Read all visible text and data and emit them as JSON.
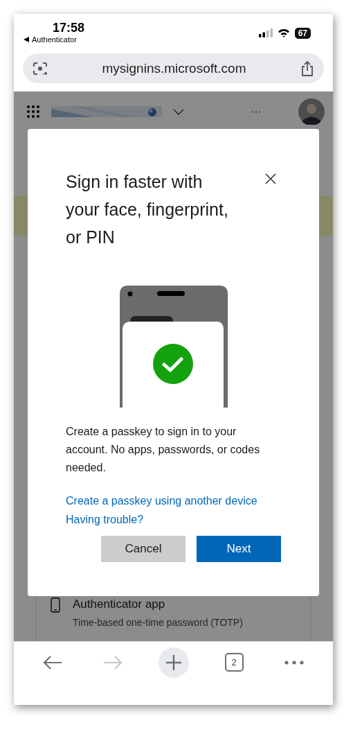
{
  "status_bar": {
    "time": "17:58",
    "back_app": "Authenticator",
    "battery": "67"
  },
  "address_bar": {
    "url": "mysignins.microsoft.com"
  },
  "page": {
    "method": {
      "title": "Authenticator app",
      "subtitle": "Time-based one-time password (TOTP)"
    }
  },
  "dialog": {
    "title": "Sign in faster with your face, fingerprint, or PIN",
    "body": "Create a passkey to sign in to your account. No apps, passwords, or codes needed.",
    "links": [
      "Create a passkey using another device",
      "Having trouble?"
    ],
    "buttons": [
      {
        "label": "Cancel",
        "kind": "secondary"
      },
      {
        "label": "Next",
        "kind": "primary"
      }
    ]
  },
  "toolbar": {
    "tab_count": "2"
  }
}
